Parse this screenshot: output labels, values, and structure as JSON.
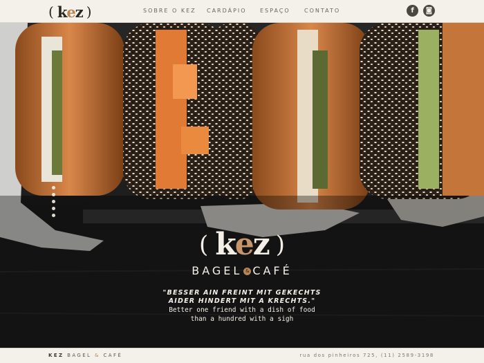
{
  "header": {
    "logo": {
      "open_paren": "(",
      "k": "k",
      "e": "e",
      "z": "z",
      "close_paren": ")"
    },
    "nav": [
      {
        "label": "SOBRE O KEZ"
      },
      {
        "label": "CARDÁPIO"
      },
      {
        "label": "ESPAÇO"
      },
      {
        "label": "CONTATO"
      }
    ],
    "social": {
      "facebook_glyph": "f",
      "instagram_glyph": "◙"
    }
  },
  "hero": {
    "slide_dots": 5,
    "logo": {
      "open_paren": "(",
      "k": "k",
      "e": "e",
      "z": "z",
      "close_paren": ")"
    },
    "tagline": {
      "left": "BAGEL",
      "amp": "&",
      "right": "CAFÉ"
    },
    "quote_de_1": "\"BESSER AIN FREINT MIT GEKECHTS",
    "quote_de_2": "AIDER HINDERT MIT A KRECHTS.\"",
    "quote_en_1": "Better one friend with a dish of food",
    "quote_en_2": "than a hundred with a sigh"
  },
  "footer": {
    "brand_bold": "KEZ",
    "brand_mid": "BAGEL",
    "brand_amp": "&",
    "brand_end": "CAFÉ",
    "address": "rua dos pinheiros 725, (11) 2589-3198"
  },
  "colors": {
    "accent": "#b58755",
    "header_bg": "#f3f1ea",
    "dark_bg": "#1c1c1c"
  }
}
